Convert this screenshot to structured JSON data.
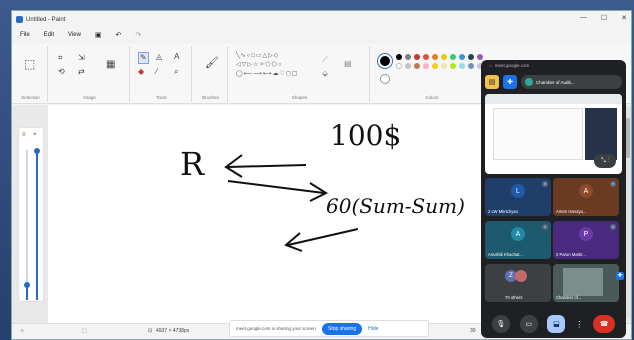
{
  "window": {
    "title": "Untitled - Paint",
    "min": "—",
    "max": "☐",
    "close": "✕"
  },
  "menu": {
    "file": "File",
    "edit": "Edit",
    "view": "View"
  },
  "ribbon": {
    "groups": [
      "Selection",
      "Image",
      "Tools",
      "Brushes",
      "Shapes",
      "Colors"
    ],
    "palette": [
      "#000000",
      "#7f7f7f",
      "#c0392b",
      "#e74c3c",
      "#e67e22",
      "#f1c40f",
      "#2ecc71",
      "#3498db",
      "#2c3e50",
      "#9b59b6",
      "#ffffff",
      "#c3c3c3",
      "#b97a57",
      "#ffaec9",
      "#ffc90e",
      "#efe4b0",
      "#b5e61d",
      "#99d9ea",
      "#7092be",
      "#c8bfe7"
    ]
  },
  "status": {
    "selection_size": "4937 × 4738px",
    "zoom_partial": "30"
  },
  "share": {
    "message": "meet.google.com is sharing your screen.",
    "stop": "Stop sharing",
    "hide": "Hide"
  },
  "meet": {
    "url": "meet.google.com",
    "chip": "Chamber of Audit...",
    "participants": [
      {
        "initial": "L",
        "name": "2 LW Mkrtchyan",
        "color": "#1e5aa8",
        "bg": "#203e6a"
      },
      {
        "initial": "A",
        "name": "Artem Harutyu...",
        "color": "#8a4b2b",
        "bg": "#6a3a22"
      },
      {
        "initial": "A",
        "name": "Anushik Khachat...",
        "color": "#1e8aa8",
        "bg": "#1e5a6e"
      },
      {
        "initial": "P",
        "name": "2 Parun Martir...",
        "color": "#6a3aa8",
        "bg": "#4a2a7e"
      }
    ],
    "others": "70 others",
    "chamber": "Chamber of..."
  },
  "handwriting": {
    "r": "R",
    "amount": "100$",
    "expr": "60(Sum-Sum)"
  }
}
